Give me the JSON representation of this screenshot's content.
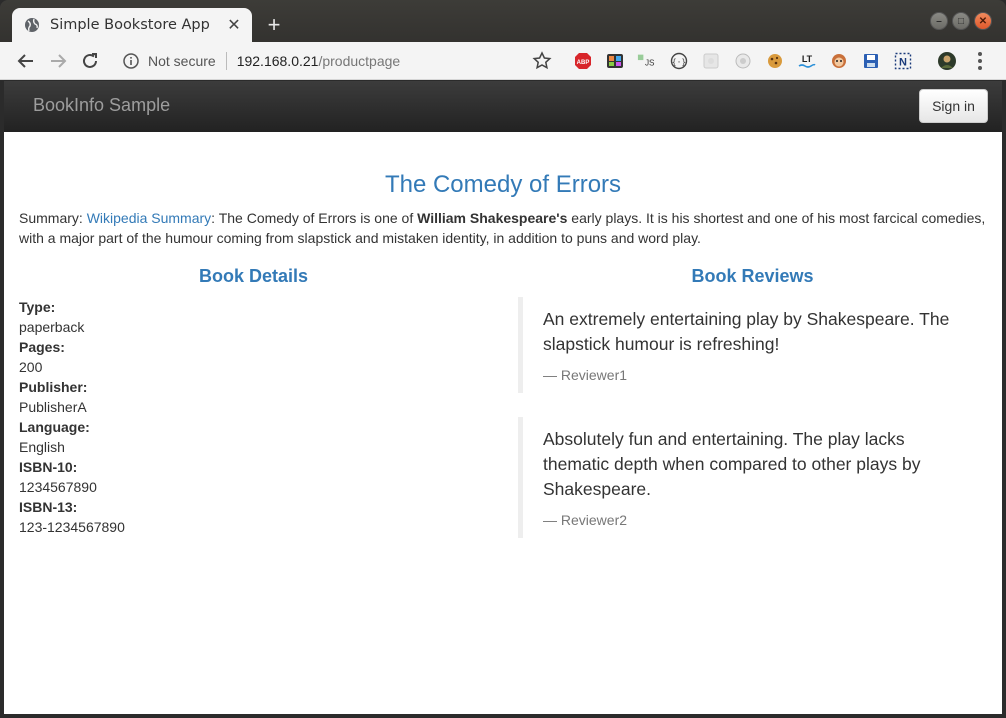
{
  "browser": {
    "tab_title": "Simple Bookstore App",
    "new_tab": "+",
    "security_label": "Not secure",
    "url_host": "192.168.0.21",
    "url_path": "/productpage",
    "extensions": [
      "abp-icon",
      "extension-icon",
      "js-icon",
      "extension-icon",
      "extension-icon",
      "extension-icon",
      "cookie-icon",
      "lt-icon",
      "extension-icon",
      "save-icon",
      "extension-icon",
      "avatar-icon"
    ],
    "abp_label": "ABP",
    "js_label": "JS",
    "lt_label": "LT",
    "n_label": "N"
  },
  "navbar": {
    "brand": "BookInfo Sample",
    "signin_label": "Sign in"
  },
  "book": {
    "title": "The Comedy of Errors",
    "summary_prefix": "Summary: ",
    "summary_link": "Wikipedia Summary",
    "summary_text_1": ": The Comedy of Errors is one of ",
    "summary_bold": "William Shakespeare's",
    "summary_text_2": " early plays. It is his shortest and one of his most farcical comedies, with a major part of the humour coming from slapstick and mistaken identity, in addition to puns and word play."
  },
  "details": {
    "heading": "Book Details",
    "fields": [
      {
        "label": "Type:",
        "value": "paperback"
      },
      {
        "label": "Pages:",
        "value": "200"
      },
      {
        "label": "Publisher:",
        "value": "PublisherA"
      },
      {
        "label": "Language:",
        "value": "English"
      },
      {
        "label": "ISBN-10:",
        "value": "1234567890"
      },
      {
        "label": "ISBN-13:",
        "value": "123-1234567890"
      }
    ]
  },
  "reviews": {
    "heading": "Book Reviews",
    "items": [
      {
        "text": "An extremely entertaining play by Shakespeare. The slapstick humour is refreshing!",
        "reviewer": "— Reviewer1"
      },
      {
        "text": "Absolutely fun and entertaining. The play lacks thematic depth when compared to other plays by Shakespeare.",
        "reviewer": "— Reviewer2"
      }
    ]
  }
}
